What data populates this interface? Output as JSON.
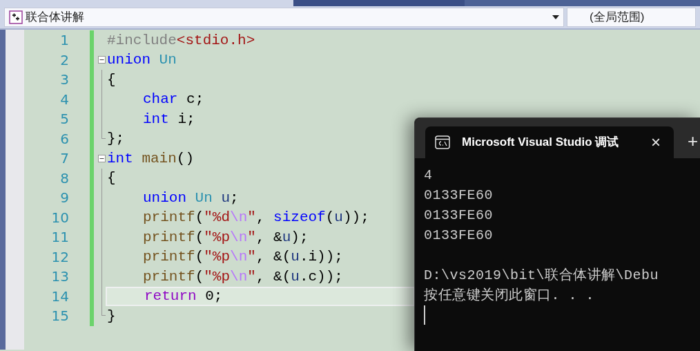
{
  "navigation_bar": {
    "file_scope": "联合体讲解",
    "member_scope": "(全局范围)"
  },
  "editor": {
    "lines": [
      {
        "number": "1",
        "current": false,
        "fold": false,
        "indented": false,
        "tokens": [
          {
            "text": "#include",
            "kind": "preproc"
          },
          {
            "text": "<stdio.h>",
            "kind": "string"
          }
        ]
      },
      {
        "number": "2",
        "current": false,
        "fold": true,
        "indented": false,
        "tokens": [
          {
            "text": "union",
            "kind": "keyword"
          },
          {
            "text": " Un",
            "kind": "type"
          }
        ]
      },
      {
        "number": "3",
        "current": false,
        "fold": false,
        "indented": false,
        "tokens": [
          {
            "text": "{",
            "kind": "plain"
          }
        ]
      },
      {
        "number": "4",
        "current": false,
        "fold": false,
        "indented": true,
        "tokens": [
          {
            "text": "char",
            "kind": "keyword"
          },
          {
            "text": " c;",
            "kind": "plain"
          }
        ]
      },
      {
        "number": "5",
        "current": false,
        "fold": false,
        "indented": true,
        "tokens": [
          {
            "text": "int",
            "kind": "keyword"
          },
          {
            "text": " i;",
            "kind": "plain"
          }
        ]
      },
      {
        "number": "6",
        "current": false,
        "fold": false,
        "indented": false,
        "tokens": [
          {
            "text": "};",
            "kind": "plain"
          }
        ]
      },
      {
        "number": "7",
        "current": false,
        "fold": true,
        "indented": false,
        "tokens": [
          {
            "text": "int",
            "kind": "keyword"
          },
          {
            "text": " main",
            "kind": "function"
          },
          {
            "text": "()",
            "kind": "plain"
          }
        ]
      },
      {
        "number": "8",
        "current": false,
        "fold": false,
        "indented": false,
        "tokens": [
          {
            "text": "{",
            "kind": "plain"
          }
        ]
      },
      {
        "number": "9",
        "current": false,
        "fold": false,
        "indented": true,
        "tokens": [
          {
            "text": "union",
            "kind": "keyword"
          },
          {
            "text": " Un",
            "kind": "type"
          },
          {
            "text": " u",
            "kind": "variable"
          },
          {
            "text": ";",
            "kind": "plain"
          }
        ]
      },
      {
        "number": "10",
        "current": false,
        "fold": false,
        "indented": true,
        "tokens": [
          {
            "text": "printf",
            "kind": "function"
          },
          {
            "text": "(",
            "kind": "plain"
          },
          {
            "text": "\"%d",
            "kind": "string"
          },
          {
            "text": "\\n",
            "kind": "escape"
          },
          {
            "text": "\"",
            "kind": "string"
          },
          {
            "text": ", ",
            "kind": "plain"
          },
          {
            "text": "sizeof",
            "kind": "keyword"
          },
          {
            "text": "(",
            "kind": "plain"
          },
          {
            "text": "u",
            "kind": "variable"
          },
          {
            "text": "));",
            "kind": "plain"
          }
        ]
      },
      {
        "number": "11",
        "current": false,
        "fold": false,
        "indented": true,
        "tokens": [
          {
            "text": "printf",
            "kind": "function"
          },
          {
            "text": "(",
            "kind": "plain"
          },
          {
            "text": "\"%p",
            "kind": "string"
          },
          {
            "text": "\\n",
            "kind": "escape"
          },
          {
            "text": "\"",
            "kind": "string"
          },
          {
            "text": ", &",
            "kind": "plain"
          },
          {
            "text": "u",
            "kind": "variable"
          },
          {
            "text": ");",
            "kind": "plain"
          }
        ]
      },
      {
        "number": "12",
        "current": false,
        "fold": false,
        "indented": true,
        "tokens": [
          {
            "text": "printf",
            "kind": "function"
          },
          {
            "text": "(",
            "kind": "plain"
          },
          {
            "text": "\"%p",
            "kind": "string"
          },
          {
            "text": "\\n",
            "kind": "escape"
          },
          {
            "text": "\"",
            "kind": "string"
          },
          {
            "text": ", &(",
            "kind": "plain"
          },
          {
            "text": "u",
            "kind": "variable"
          },
          {
            "text": ".i));",
            "kind": "plain"
          }
        ]
      },
      {
        "number": "13",
        "current": false,
        "fold": false,
        "indented": true,
        "tokens": [
          {
            "text": "printf",
            "kind": "function"
          },
          {
            "text": "(",
            "kind": "plain"
          },
          {
            "text": "\"%p",
            "kind": "string"
          },
          {
            "text": "\\n",
            "kind": "escape"
          },
          {
            "text": "\"",
            "kind": "string"
          },
          {
            "text": ", &(",
            "kind": "plain"
          },
          {
            "text": "u",
            "kind": "variable"
          },
          {
            "text": ".c));",
            "kind": "plain"
          }
        ]
      },
      {
        "number": "14",
        "current": true,
        "fold": false,
        "indented": true,
        "tokens": [
          {
            "text": "return",
            "kind": "control"
          },
          {
            "text": " 0;",
            "kind": "plain"
          }
        ]
      },
      {
        "number": "15",
        "current": false,
        "fold": false,
        "indented": false,
        "tokens": [
          {
            "text": "}",
            "kind": "plain"
          }
        ]
      }
    ]
  },
  "console": {
    "tab_title": "Microsoft Visual Studio 调试",
    "close": "×",
    "new_tab": "+",
    "output_blocks": [
      {
        "lines": [
          "4",
          "0133FE60",
          "0133FE60",
          "0133FE60"
        ]
      },
      {
        "lines": [
          "D:\\vs2019\\bit\\联合体讲解\\Debu",
          "按任意键关闭此窗口. . ."
        ]
      }
    ]
  }
}
